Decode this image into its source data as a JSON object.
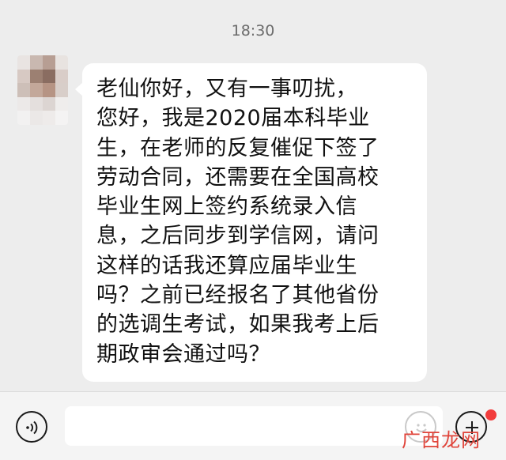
{
  "header": {
    "time": "18:30"
  },
  "message": {
    "lines": [
      "老仙你好，又有一事叨扰，",
      "您好，我是2020届本科毕业",
      "生，在老师的反复催促下签了",
      "劳动合同，还需要在全国高校",
      "毕业生网上签约系统录入信",
      "息，之后同步到学信网，请问",
      "这样的话我还算应届毕业生",
      "吗？之前已经报名了其他省份",
      "的选调生考试，如果我考上后",
      "期政审会通过吗？"
    ]
  },
  "input_bar": {
    "voice_icon": "voice-icon",
    "emoji_icon": "emoji-icon",
    "plus_icon": "plus-icon",
    "notification_color": "#f23c3c"
  },
  "watermark": {
    "text": "广西龙网"
  }
}
